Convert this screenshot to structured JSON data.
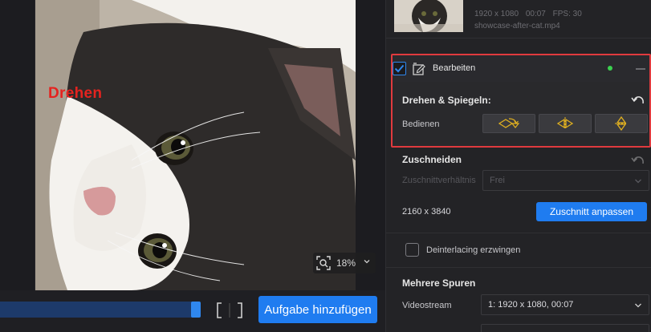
{
  "preview": {
    "overlay_label": "Drehen",
    "zoom_level": "18%"
  },
  "bottombar": {
    "timeline_progress": 1.0,
    "add_task_label": "Aufgabe hinzufügen"
  },
  "file": {
    "resolution": "1920 x 1080",
    "duration": "00:07",
    "fps": "FPS: 30",
    "filename": "showcase-after-cat.mp4"
  },
  "bearbeiten": {
    "title": "Bearbeiten",
    "enabled": true,
    "status_color": "#3bd14f",
    "rotate_section_title": "Drehen & Spiegeln:",
    "operate_label": "Bedienen",
    "buttons": [
      "rotate-icon",
      "flip-horizontal-icon",
      "flip-vertical-icon"
    ]
  },
  "zuschneiden": {
    "title": "Zuschneiden",
    "ratio_label": "Zuschnittverhältnis",
    "ratio_value": "Frei",
    "dimensions": "2160 x 3840",
    "crop_button_label": "Zuschnitt anpassen"
  },
  "deinterlacing": {
    "label": "Deinterlacing erzwingen",
    "checked": false
  },
  "tracks": {
    "title": "Mehrere Spuren",
    "videostream_label": "Videostream",
    "videostream_value": "1: 1920 x 1080,  00:07"
  },
  "colors": {
    "accent": "#1f7cf0",
    "highlight_border": "#e03a3e",
    "icon_yellow": "#e0b020"
  }
}
